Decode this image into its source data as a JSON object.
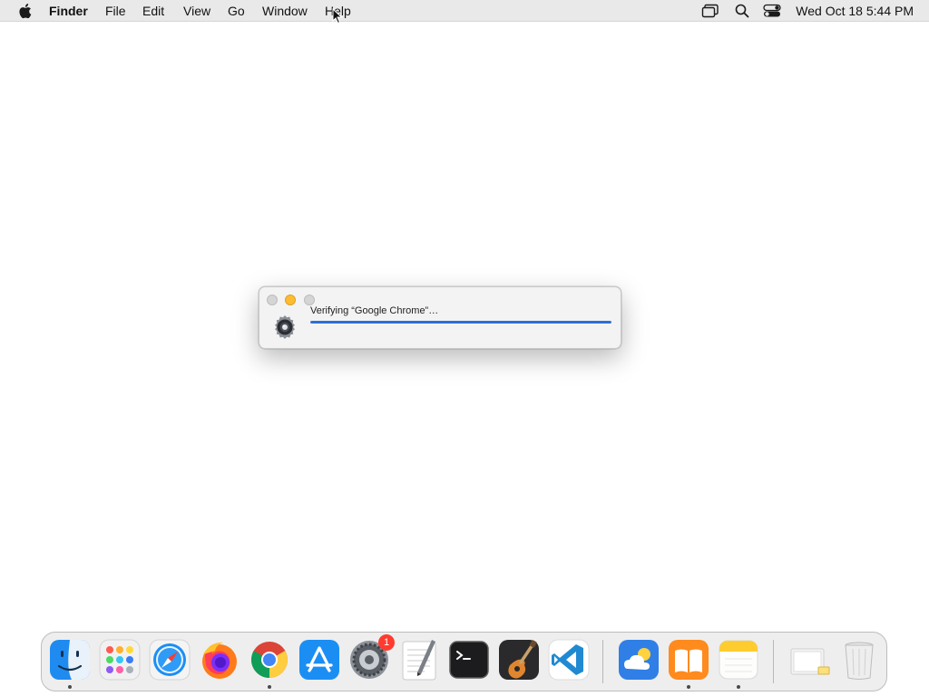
{
  "menubar": {
    "app_name": "Finder",
    "menus": [
      "File",
      "Edit",
      "View",
      "Go",
      "Window",
      "Help"
    ],
    "status_icons": [
      "screen-mirroring-icon",
      "search-icon",
      "control-center-icon"
    ],
    "clock": "Wed Oct 18  5:44 PM"
  },
  "dialog": {
    "message": "Verifying “Google Chrome”…",
    "progress": 1.0,
    "icon": "gatekeeper-icon",
    "accent": "#2d6fd6"
  },
  "dock": {
    "items": [
      {
        "name": "Finder",
        "icon": "finder-icon",
        "running": true
      },
      {
        "name": "Launchpad",
        "icon": "launchpad-icon",
        "running": false
      },
      {
        "name": "Safari",
        "icon": "safari-icon",
        "running": false
      },
      {
        "name": "Firefox",
        "icon": "firefox-icon",
        "running": false
      },
      {
        "name": "Google Chrome",
        "icon": "chrome-icon",
        "running": true
      },
      {
        "name": "App Store",
        "icon": "app-store-icon",
        "running": false
      },
      {
        "name": "System Settings",
        "icon": "system-settings-icon",
        "running": false,
        "badge": "1"
      },
      {
        "name": "TextEdit",
        "icon": "textedit-icon",
        "running": false
      },
      {
        "name": "Terminal",
        "icon": "terminal-icon",
        "running": false
      },
      {
        "name": "GarageBand",
        "icon": "garageband-icon",
        "running": false
      },
      {
        "name": "Visual Studio Code",
        "icon": "vscode-icon",
        "running": false
      },
      {
        "name": "Weather",
        "icon": "weather-icon",
        "running": false
      },
      {
        "name": "Books",
        "icon": "books-icon",
        "running": true
      },
      {
        "name": "Notes",
        "icon": "notes-icon",
        "running": true
      },
      {
        "name": "Downloads",
        "icon": "downloads-folder-icon",
        "running": false
      },
      {
        "name": "Trash",
        "icon": "trash-icon",
        "running": false
      }
    ]
  }
}
